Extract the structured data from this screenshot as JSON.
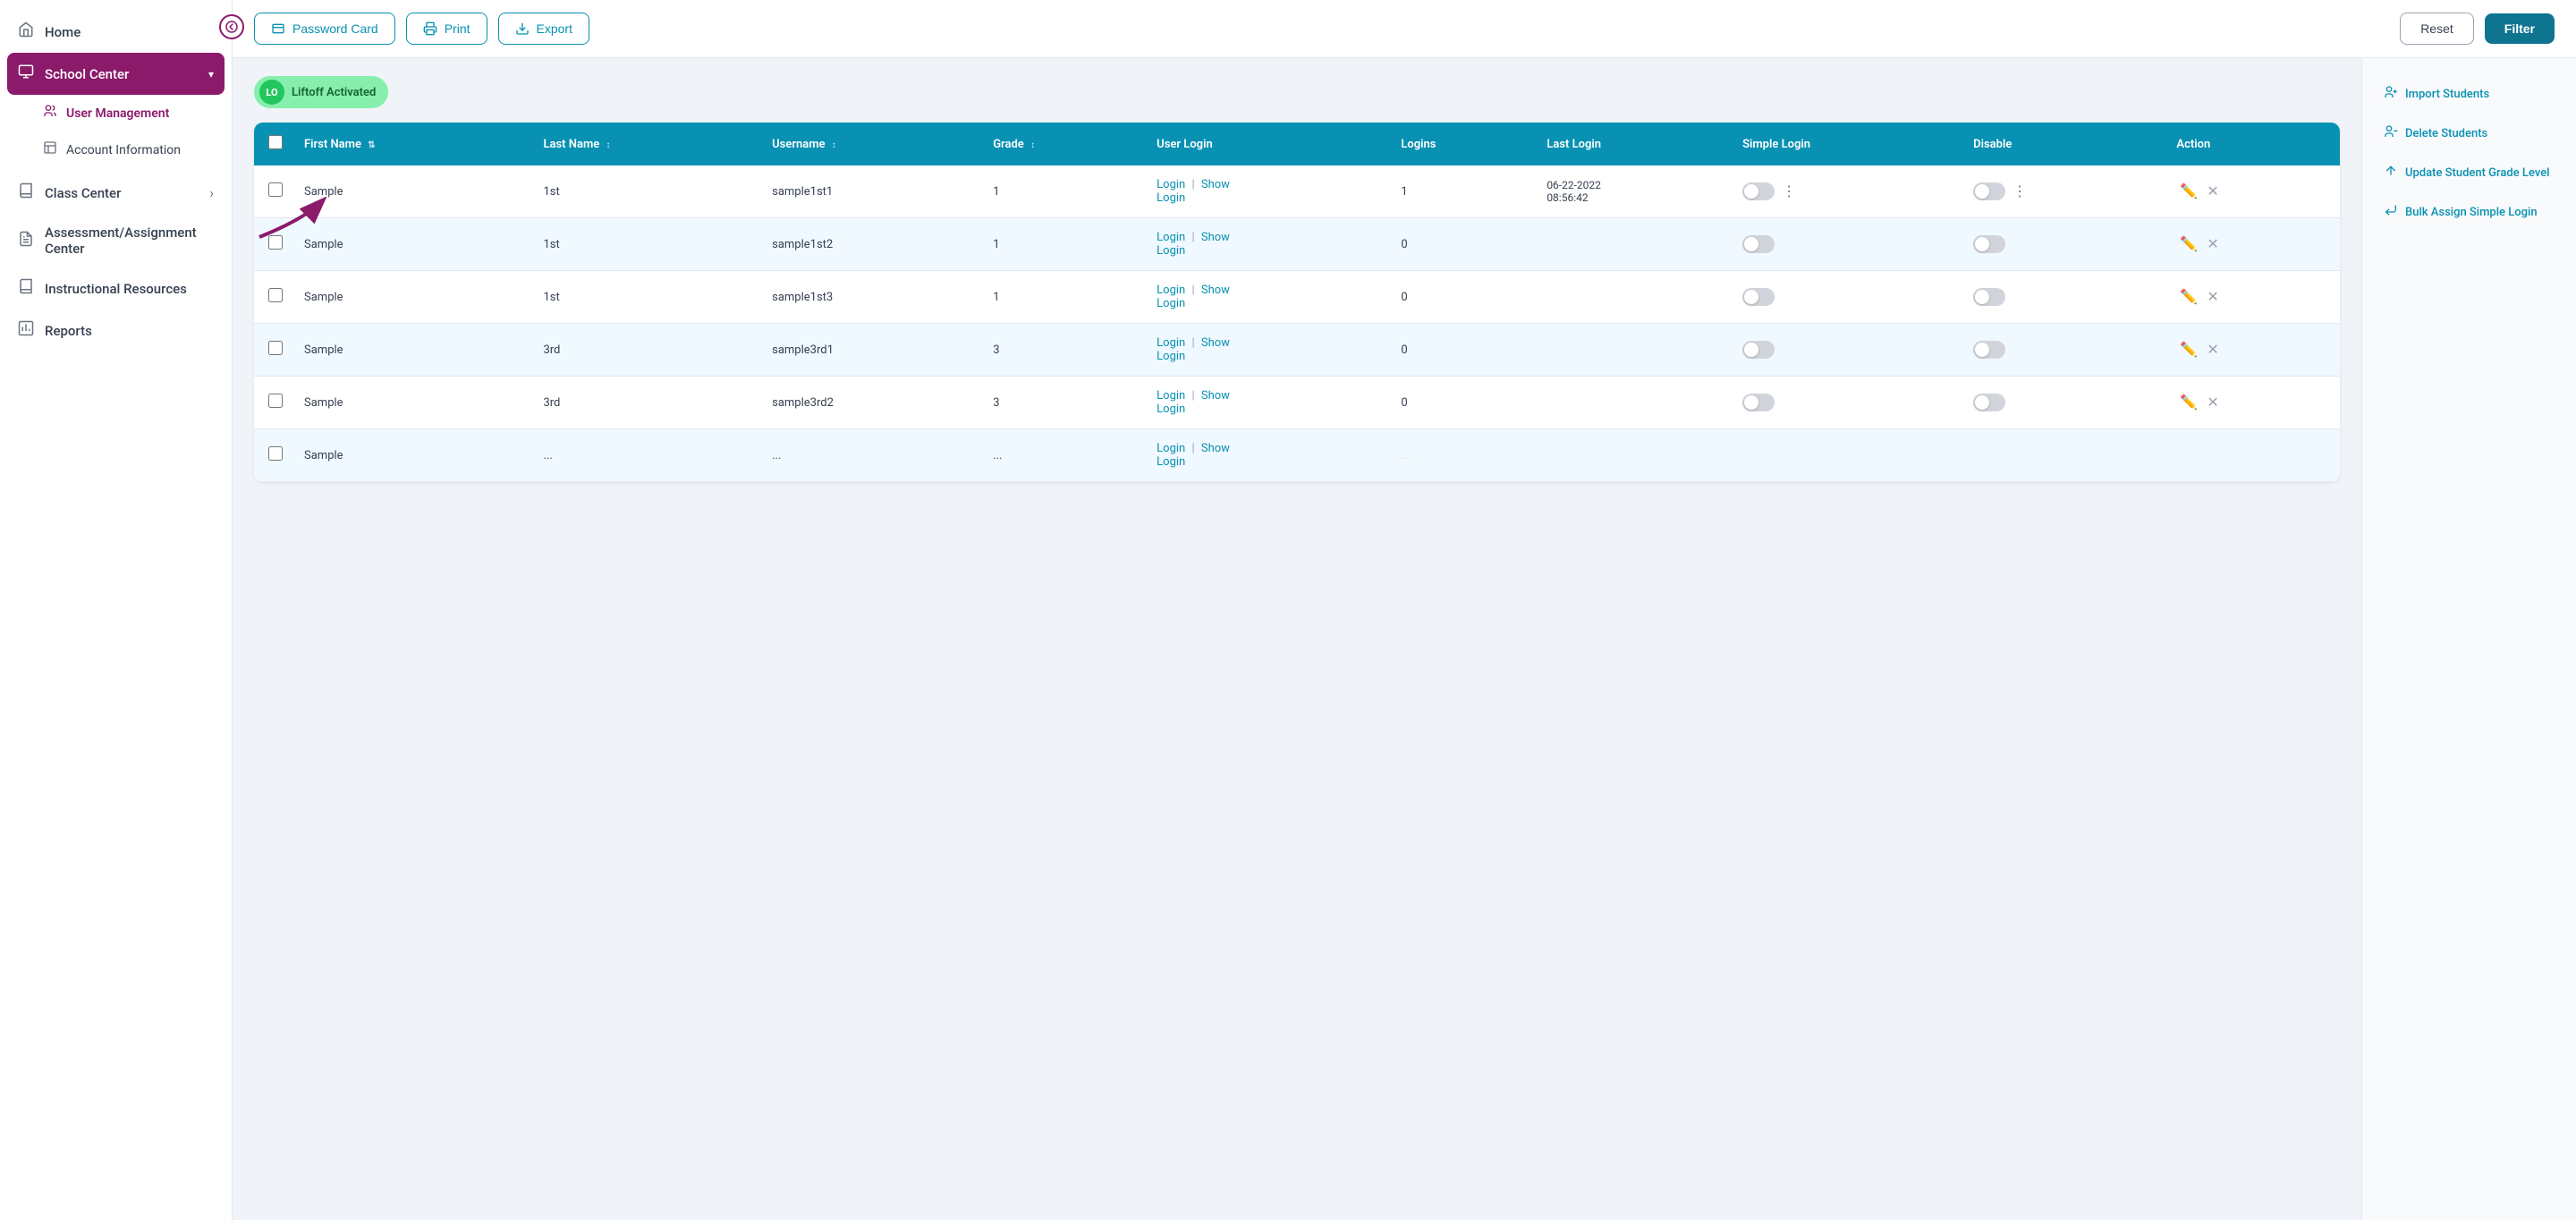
{
  "sidebar": {
    "back_btn": "←",
    "items": [
      {
        "id": "home",
        "label": "Home",
        "icon": "🏠",
        "active": false
      },
      {
        "id": "school-center",
        "label": "School Center",
        "icon": "🏫",
        "active": true,
        "chevron": "▾"
      },
      {
        "id": "user-management",
        "label": "User Management",
        "icon": "👥",
        "sub": true
      },
      {
        "id": "account-information",
        "label": "Account Information",
        "icon": "📋",
        "sub": true
      },
      {
        "id": "class-center",
        "label": "Class Center",
        "icon": "📖",
        "active": false,
        "chevron": "›"
      },
      {
        "id": "assessment-center",
        "label": "Assessment/Assignment Center",
        "icon": "📝",
        "active": false
      },
      {
        "id": "instructional-resources",
        "label": "Instructional Resources",
        "icon": "📚",
        "active": false
      },
      {
        "id": "reports",
        "label": "Reports",
        "icon": "📊",
        "active": false
      }
    ]
  },
  "toolbar": {
    "password_card_label": "Password Card",
    "print_label": "Print",
    "export_label": "Export",
    "reset_label": "Reset",
    "filter_label": "Filter"
  },
  "right_panel": {
    "actions": [
      {
        "id": "import-students",
        "label": "Import Students",
        "icon": "👤+"
      },
      {
        "id": "delete-students",
        "label": "Delete Students",
        "icon": "👤-"
      },
      {
        "id": "update-grade-level",
        "label": "Update Student Grade Level",
        "icon": "↑"
      },
      {
        "id": "bulk-assign",
        "label": "Bulk Assign Simple Login",
        "icon": "←|"
      }
    ]
  },
  "liftoff": {
    "badge_text": "LO",
    "label": "Liftoff Activated"
  },
  "table": {
    "columns": [
      {
        "id": "checkbox",
        "label": ""
      },
      {
        "id": "first-name",
        "label": "First Name",
        "sortable": true
      },
      {
        "id": "last-name",
        "label": "Last Name",
        "sortable": true
      },
      {
        "id": "username",
        "label": "Username",
        "sortable": true
      },
      {
        "id": "grade",
        "label": "Grade",
        "sortable": true
      },
      {
        "id": "user-login",
        "label": "User Login"
      },
      {
        "id": "logins",
        "label": "Logins"
      },
      {
        "id": "last-login",
        "label": "Last Login"
      },
      {
        "id": "simple-login",
        "label": "Simple Login"
      },
      {
        "id": "disable",
        "label": "Disable"
      },
      {
        "id": "action",
        "label": "Action"
      }
    ],
    "rows": [
      {
        "id": 1,
        "first": "Sample",
        "last": "1st",
        "username": "sample1st1",
        "grade": "1",
        "logins": "1",
        "last_login": "06-22-2022\n08:56:42",
        "simple_checked": false,
        "disable_checked": false
      },
      {
        "id": 2,
        "first": "Sample",
        "last": "1st",
        "username": "sample1st2",
        "grade": "1",
        "logins": "0",
        "last_login": "",
        "simple_checked": false,
        "disable_checked": false
      },
      {
        "id": 3,
        "first": "Sample",
        "last": "1st",
        "username": "sample1st3",
        "grade": "1",
        "logins": "0",
        "last_login": "",
        "simple_checked": false,
        "disable_checked": false
      },
      {
        "id": 4,
        "first": "Sample",
        "last": "3rd",
        "username": "sample3rd1",
        "grade": "3",
        "logins": "0",
        "last_login": "",
        "simple_checked": false,
        "disable_checked": false
      },
      {
        "id": 5,
        "first": "Sample",
        "last": "3rd",
        "username": "sample3rd2",
        "grade": "3",
        "logins": "0",
        "last_login": "",
        "simple_checked": false,
        "disable_checked": false
      },
      {
        "id": 6,
        "first": "Sample",
        "last": "...",
        "username": "...",
        "grade": "...",
        "logins": "...",
        "last_login": "",
        "simple_checked": false,
        "disable_checked": false
      }
    ]
  }
}
